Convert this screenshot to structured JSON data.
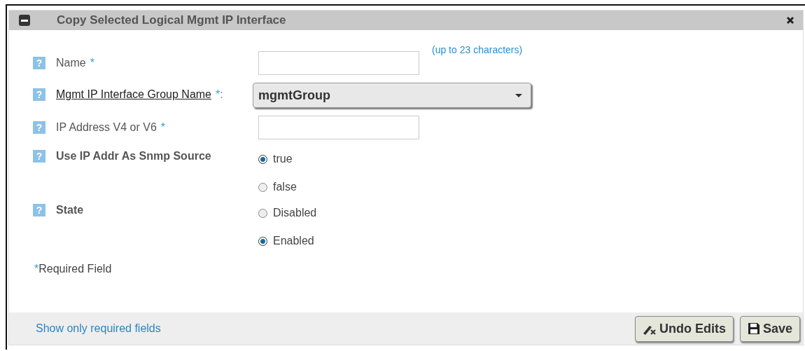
{
  "dialog": {
    "title": "Copy Selected Logical Mgmt IP Interface"
  },
  "fields": [
    {
      "kind": "text",
      "help": "?",
      "label": "Name",
      "link": false,
      "required_mark": "*",
      "hint": "(up to 23 characters)"
    },
    {
      "kind": "select",
      "help": "?",
      "label": "Mgmt IP Interface Group Name",
      "link": true,
      "required_mark": "*:",
      "value": "mgmtGroup"
    },
    {
      "kind": "text",
      "help": "?",
      "label": "IP Address V4 or V6",
      "link": false,
      "required_mark": "*"
    },
    {
      "kind": "radio",
      "help": "?",
      "label": "Use IP Addr As Snmp Source",
      "options": [
        {
          "label": "true",
          "selected": true
        },
        {
          "label": "false",
          "selected": false
        }
      ]
    },
    {
      "kind": "radio",
      "help": "?",
      "label": "State",
      "options": [
        {
          "label": "Disabled",
          "selected": false
        },
        {
          "label": "Enabled",
          "selected": true
        }
      ]
    }
  ],
  "required_note": {
    "mark": "*",
    "text": "Required Field"
  },
  "footer": {
    "link": "Show only required fields",
    "buttons": [
      {
        "kind": "undo",
        "label": "Undo Edits"
      },
      {
        "kind": "save",
        "label": "Save"
      }
    ]
  }
}
